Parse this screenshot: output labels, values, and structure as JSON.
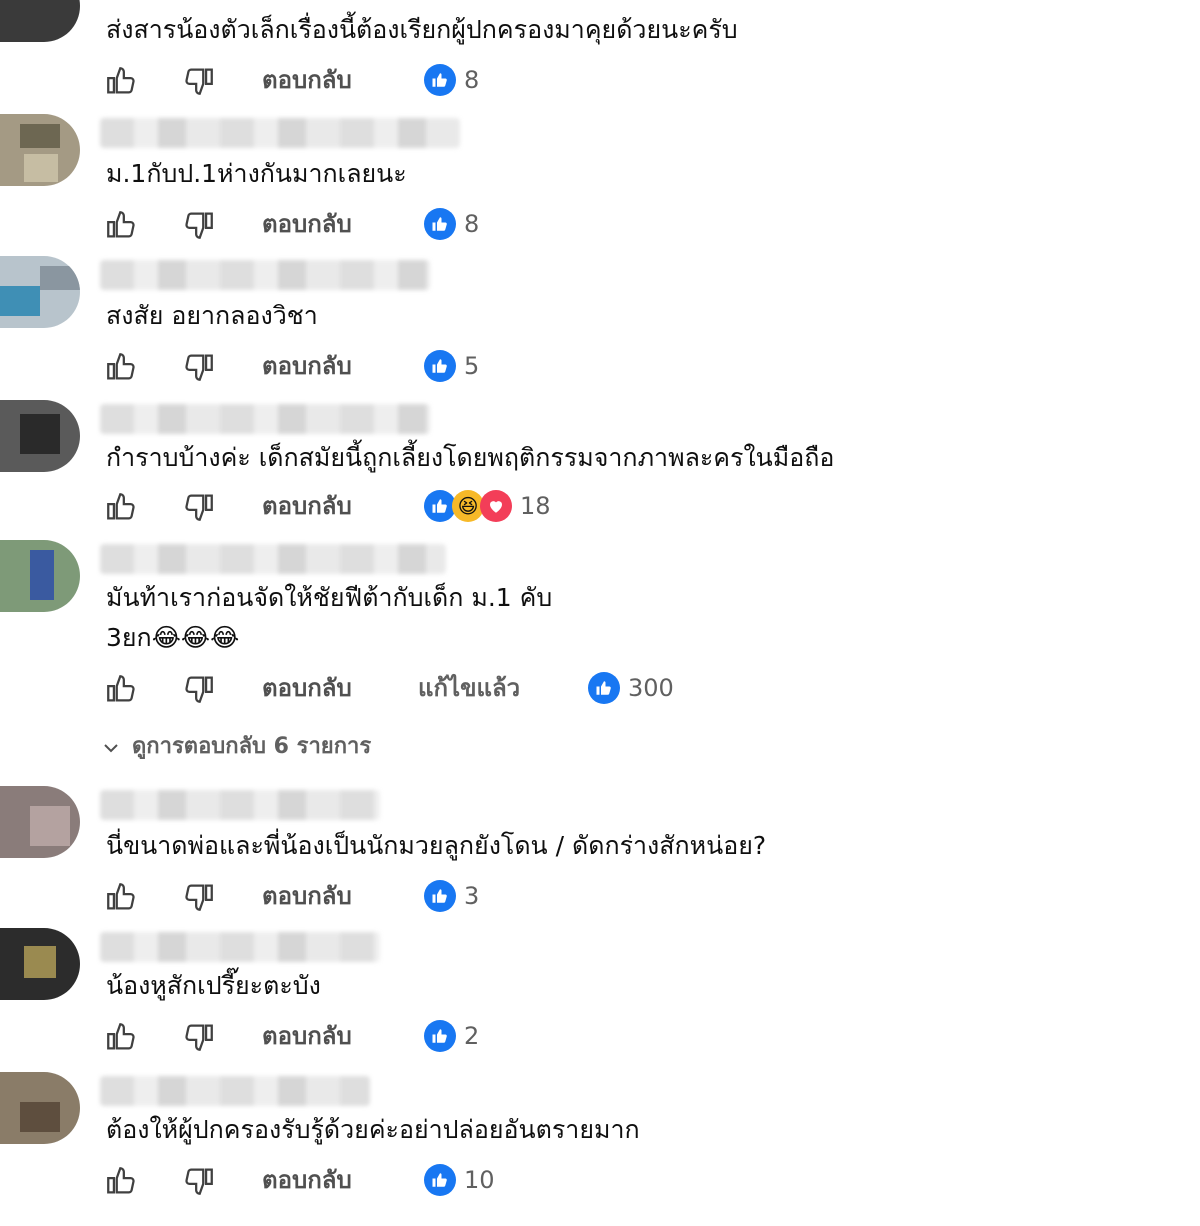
{
  "comments": [
    {
      "text": "ส่งสารน้องตัวเล็กเรื่องนี้ต้องเรียกผู้ปกครองมาคุยด้วยนะครับ",
      "reply": "ตอบกลับ",
      "count": "8",
      "reactions": [
        "like-icon"
      ]
    },
    {
      "text": "ม.1กับป.1ห่างกันมากเลยนะ",
      "reply": "ตอบกลับ",
      "count": "8",
      "reactions": [
        "like-icon"
      ]
    },
    {
      "text": "สงสัย อยากลองวิชา",
      "reply": "ตอบกลับ",
      "count": "5",
      "reactions": [
        "like-icon"
      ]
    },
    {
      "text": "กำราบบ้างค่ะ เด็กสมัยนี้ถูกเลี้ยงโดยพฤติกรรมจากภาพละครในมือถือ",
      "reply": "ตอบกลับ",
      "count": "18",
      "reactions": [
        "like-icon",
        "haha-icon",
        "love-icon"
      ]
    },
    {
      "text": "มันท้าเราก่อนจัดให้ชัยฟีต้ากับเด็ก ม.1 คับ",
      "text2": "3ยก😂😂😂",
      "reply": "ตอบกลับ",
      "edited": "แก้ไขแล้ว",
      "count": "300",
      "reactions": [
        "like-icon"
      ]
    },
    {
      "text": "นี่ขนาดพ่อและพี่น้องเป็นนักมวยลูกยังโดน / ดัดกร่างสักหน่อย?",
      "reply": "ตอบกลับ",
      "count": "3",
      "reactions": [
        "like-icon"
      ]
    },
    {
      "text": "น้องหูสักเปรี๊ยะตะบัง",
      "reply": "ตอบกลับ",
      "count": "2",
      "reactions": [
        "like-icon"
      ]
    },
    {
      "text": "ต้องให้ผู้ปกครองรับรู้ด้วยค่ะอย่าปล่อยอันตรายมาก",
      "reply": "ตอบกลับ",
      "count": "10",
      "reactions": [
        "like-icon"
      ]
    }
  ],
  "view_replies": "ดูการตอบกลับ 6 รายการ",
  "colors": {
    "like": "#1877f2",
    "haha": "#f7b928",
    "love": "#f33e58",
    "meta": "#606060"
  }
}
